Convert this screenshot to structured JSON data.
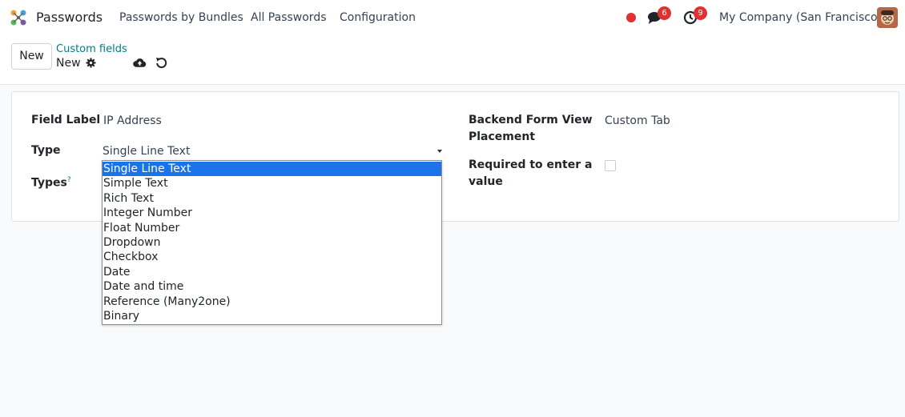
{
  "navbar": {
    "app_name": "Passwords",
    "menu": [
      "Passwords by Bundles",
      "All Passwords",
      "Configuration"
    ],
    "messages_count": "6",
    "activities_count": "9",
    "company": "My Company (San Francisco)"
  },
  "control_panel": {
    "new_label": "New",
    "breadcrumb_parent": "Custom fields",
    "breadcrumb_current": "New"
  },
  "form": {
    "field_label": {
      "label": "Field Label",
      "value": "IP Address"
    },
    "type": {
      "label": "Type",
      "value": "Single Line Text"
    },
    "types": {
      "label": "Types",
      "help": "?"
    },
    "backend_placement": {
      "label_line1": "Backend Form View",
      "label_line2": "Placement",
      "value": "Custom Tab"
    },
    "required": {
      "label_line1": "Required to enter a",
      "label_line2": "value",
      "checked": false
    }
  },
  "dropdown": {
    "selected_index": 0,
    "options": [
      "Single Line Text",
      "Simple Text",
      "Rich Text",
      "Integer Number",
      "Float Number",
      "Dropdown",
      "Checkbox",
      "Date",
      "Date and time",
      "Reference (Many2one)",
      "Binary"
    ]
  },
  "colors": {
    "accent": "#017e84",
    "badge": "#e03131",
    "selection": "#1a73e8"
  }
}
